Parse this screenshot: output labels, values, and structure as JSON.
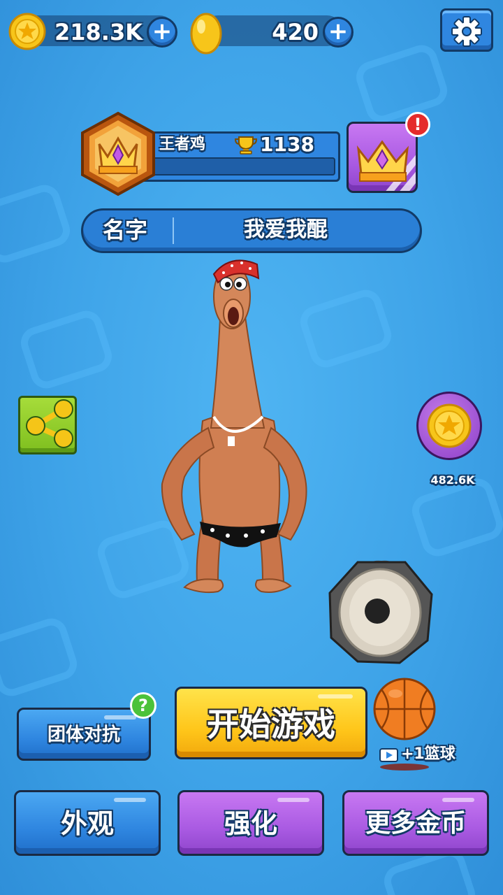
{
  "resources": {
    "coins": "218.3K",
    "eggs": "420"
  },
  "profile": {
    "rank_title": "王者鸡",
    "trophies": "1138",
    "name_label": "名字",
    "name_value": "我爱我醌"
  },
  "side": {
    "coin_reward": "482.6K"
  },
  "buttons": {
    "team_battle": "团体对抗",
    "start_game": "开始游戏",
    "ad_reward": "+1篮球",
    "appearance": "外观",
    "upgrade": "强化",
    "more_coins": "更多金币"
  },
  "colors": {
    "background": "#3ea3e8",
    "button_blue": "#2f86e0",
    "button_purple": "#a95ae2",
    "button_yellow": "#ffc61a",
    "coin_gold": "#f5c518",
    "alert_red": "#e52b2b",
    "help_green": "#4cc23a"
  }
}
